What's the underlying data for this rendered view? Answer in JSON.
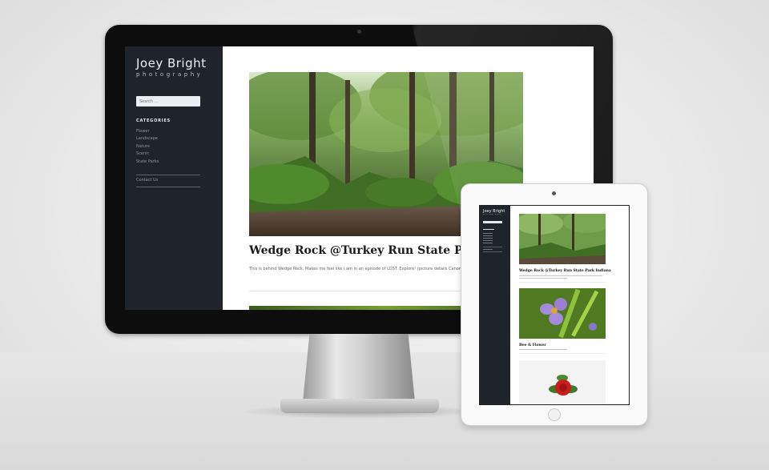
{
  "site": {
    "brand_name": "Joey Bright",
    "brand_tagline": "photography"
  },
  "sidebar": {
    "search_placeholder": "Search …",
    "categories_title": "CATEGORIES",
    "categories": [
      "Flower",
      "Landscape",
      "Nature",
      "Scenic",
      "State Parks"
    ],
    "contact_label": "Contact Us"
  },
  "post": {
    "title": "Wedge Rock @Turkey Run State Park Indiana",
    "excerpt": "This is behind Wedge Rock. Makes me feel like I am in an episode of LOST. Explore! (picture details Canon 5dMark, tripod, HDR)"
  },
  "tablet": {
    "post1_title": "Wedge Rock @Turkey Run State Park Indiana",
    "post2_title": "Bee & Flower"
  },
  "colors": {
    "sidebar_bg": "#1f242b",
    "page_bg": "#ffffff",
    "bezel": "#0d0d0d"
  }
}
